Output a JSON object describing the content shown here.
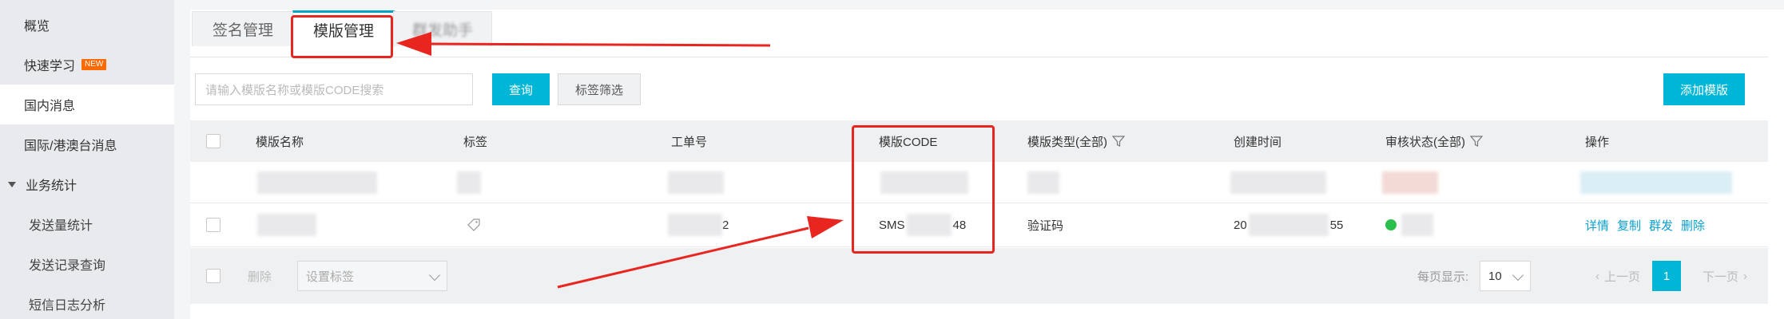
{
  "sidebar": {
    "items": [
      {
        "label": "概览"
      },
      {
        "label": "快速学习",
        "badge": "NEW"
      },
      {
        "label": "国内消息"
      },
      {
        "label": "国际/港澳台消息"
      },
      {
        "label": "业务统计"
      },
      {
        "label": "发送量统计"
      },
      {
        "label": "发送记录查询"
      },
      {
        "label": "短信日志分析"
      }
    ]
  },
  "tabs": [
    {
      "label": "签名管理"
    },
    {
      "label": "模版管理"
    },
    {
      "label": "群发助手"
    }
  ],
  "toolbar": {
    "search_placeholder": "请输入模版名称或模版CODE搜索",
    "query_label": "查询",
    "tag_filter_label": "标签筛选",
    "add_template_label": "添加模版"
  },
  "table": {
    "headers": {
      "name": "模版名称",
      "tag": "标签",
      "ticket": "工单号",
      "code": "模版CODE",
      "type": "模版类型(全部)",
      "created": "创建时间",
      "status": "审核状态(全部)",
      "actions": "操作"
    },
    "row2": {
      "ticket_suffix": "2",
      "code_prefix": "SMS",
      "code_suffix": "48",
      "type": "验证码",
      "created_prefix": "20",
      "created_suffix": "55"
    },
    "actions": [
      "详情",
      "复制",
      "群发",
      "删除"
    ]
  },
  "footer": {
    "delete_label": "删除",
    "set_tag_placeholder": "设置标签",
    "per_page_label": "每页显示:",
    "per_page_value": "10",
    "prev_label": "上一页",
    "current_page": "1",
    "next_label": "下一页"
  },
  "colors": {
    "accent": "#00b6d6",
    "annotation": "#e8251f"
  }
}
